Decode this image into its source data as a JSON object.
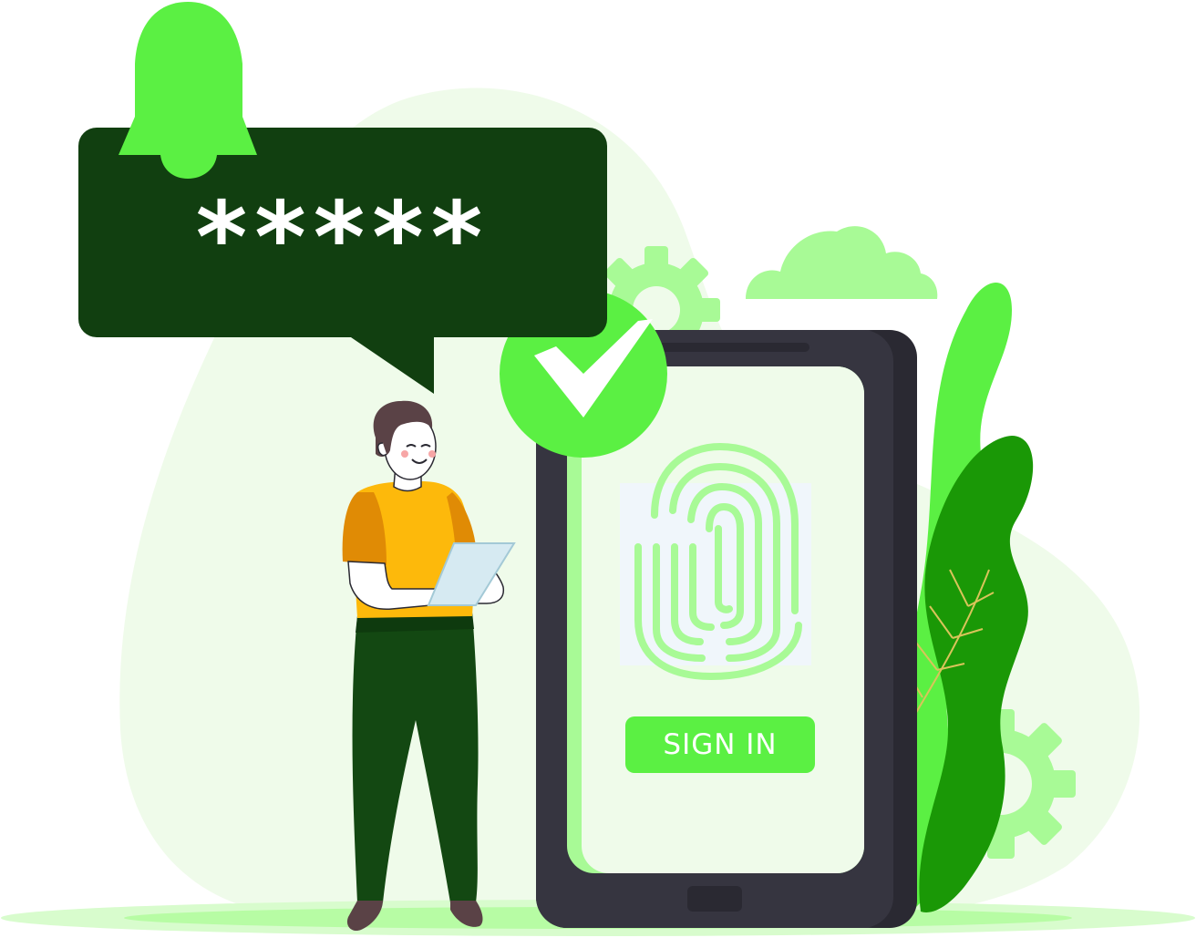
{
  "speech_bubble": {
    "password_mask": "*****"
  },
  "phone": {
    "signin_label": "SIGN IN"
  },
  "colors": {
    "dark_green": "#113f10",
    "bright_green": "#5bf043",
    "light_green": "#a8fa96",
    "pale_green": "#effbea",
    "leaf_dark": "#1a9806",
    "phone_body": "#363540",
    "shirt": "#fdb90b",
    "pants": "#134812"
  },
  "icons": [
    "bell-icon",
    "check-icon",
    "fingerprint-icon",
    "gear-icon",
    "cloud-icon",
    "tablet-icon"
  ]
}
